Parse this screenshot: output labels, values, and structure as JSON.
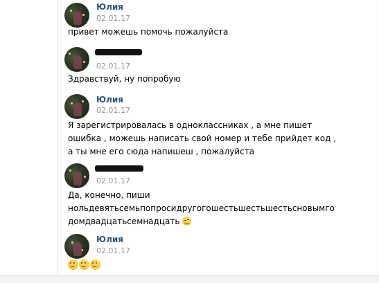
{
  "messages": [
    {
      "author": "Юлия",
      "author_redacted": false,
      "date": "02.01.17",
      "lines": [
        "привет можешь помочь пожалуйста"
      ]
    },
    {
      "author": "",
      "author_redacted": true,
      "date": "02.01.17",
      "lines": [
        "Здравствуй, ну попробую"
      ]
    },
    {
      "author": "Юлия",
      "author_redacted": false,
      "date": "02.01.17",
      "lines": [
        "Я зарегистрировалась в одноклассниках , а мне пишет",
        "ошибка , можешь написать свой номер и тебе прийдет код ,",
        "а ты мне его сюда напишеш , пожалуйста"
      ]
    },
    {
      "author": "",
      "author_redacted": true,
      "date": "02.01.17",
      "lines": [
        "Да, конечно, пиши",
        "нольдевятьсемьпопросидругогошестьшестьшестьсновымго",
        "домдвадцатьсемнадцать"
      ],
      "trailing_emoji": [
        "wink-emoji"
      ]
    },
    {
      "author": "Юлия",
      "author_redacted": false,
      "date": "02.01.17",
      "lines": [
        ""
      ],
      "trailing_emoji": [
        "smile-emoji",
        "smile-emoji",
        "smile-emoji"
      ]
    }
  ],
  "colors": {
    "author_name": "#2a5885",
    "date": "#939393",
    "text": "#000000",
    "redaction": "#111111"
  }
}
